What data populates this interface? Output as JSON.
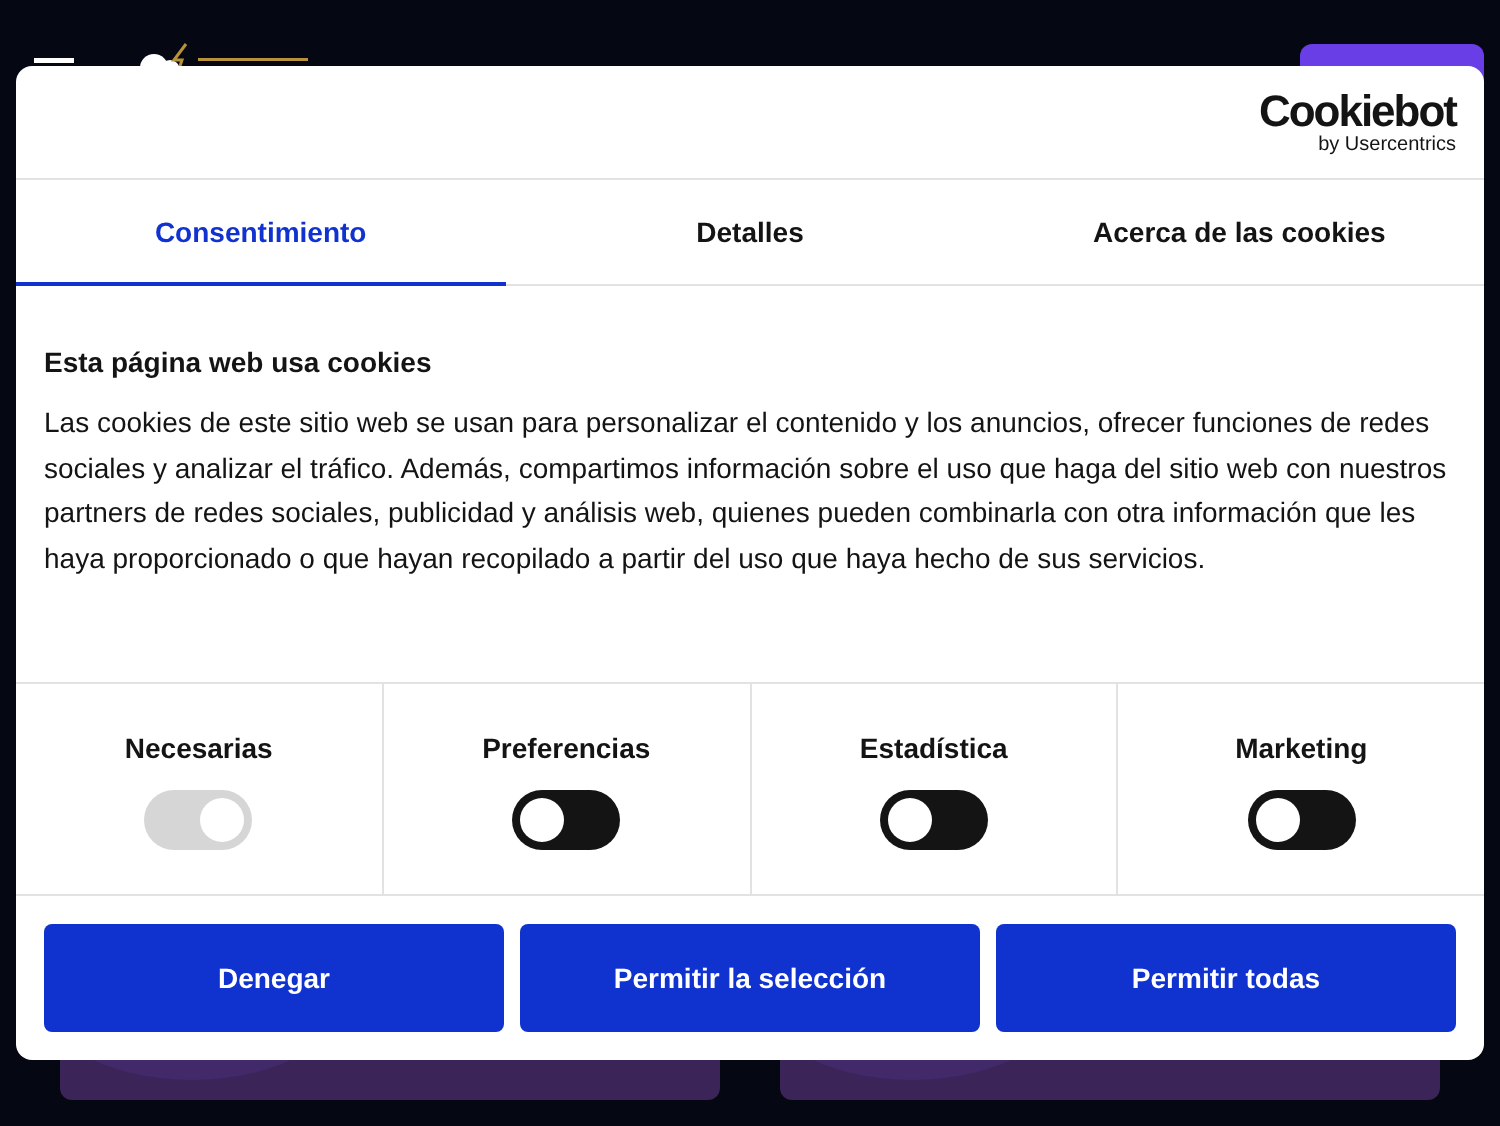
{
  "brand": {
    "name": "Cookiebot",
    "byline": "by Usercentrics"
  },
  "tabs": [
    {
      "label": "Consentimiento",
      "selected": true
    },
    {
      "label": "Detalles",
      "selected": false
    },
    {
      "label": "Acerca de las cookies",
      "selected": false
    }
  ],
  "heading": "Esta página web usa cookies",
  "body": "Las cookies de este sitio web se usan para personalizar el contenido y los anuncios, ofrecer funciones de redes sociales y analizar el tráfico. Además, compartimos información sobre el uso que haga del sitio web con nuestros partners de redes sociales, publicidad y análisis web, quienes pueden combinarla con otra información que les haya proporcionado o que hayan recopilado a partir del uso que haya hecho de sus servicios.",
  "categories": [
    {
      "label": "Necesarias",
      "checked": true,
      "disabled": true
    },
    {
      "label": "Preferencias",
      "checked": false,
      "disabled": false
    },
    {
      "label": "Estadística",
      "checked": false,
      "disabled": false
    },
    {
      "label": "Marketing",
      "checked": false,
      "disabled": false
    }
  ],
  "buttons": [
    "Denegar",
    "Permitir la selección",
    "Permitir todas"
  ]
}
